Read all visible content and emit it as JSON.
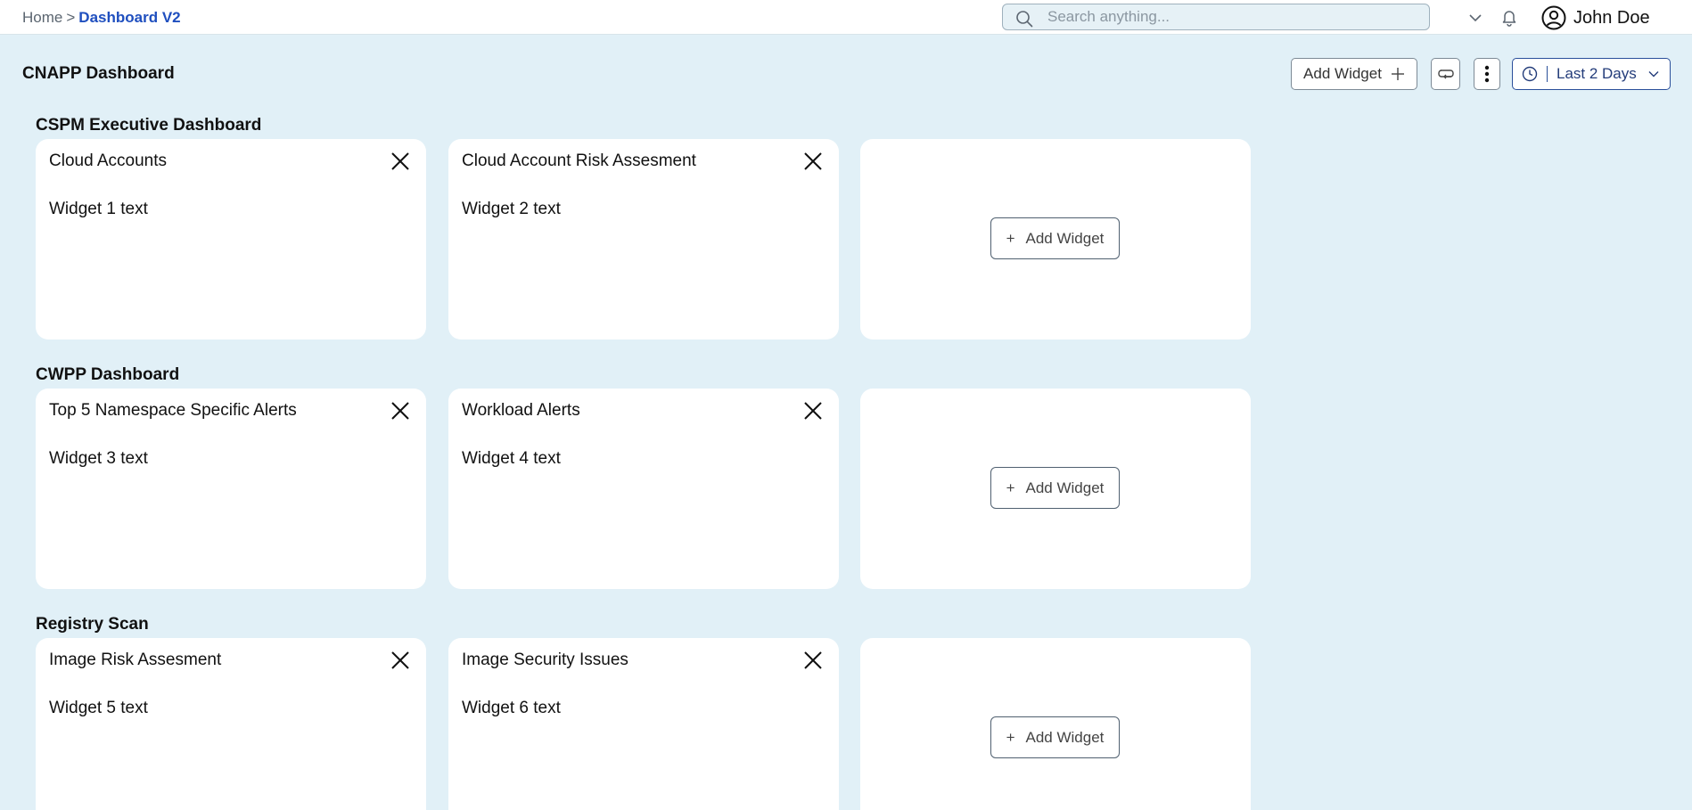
{
  "breadcrumb": {
    "home": "Home",
    "separator": ">",
    "current": "Dashboard V2"
  },
  "search": {
    "placeholder": "Search anything..."
  },
  "user": {
    "name": "John Doe"
  },
  "header": {
    "title": "CNAPP Dashboard",
    "add_widget_label": "Add Widget",
    "time_range_label": "Last 2 Days"
  },
  "colors": {
    "background": "#e1f0f7",
    "accent": "#1f4fbf",
    "card": "#ffffff"
  },
  "sections": [
    {
      "title": "CSPM Executive Dashboard",
      "widgets": [
        {
          "title": "Cloud Accounts",
          "text": "Widget 1 text"
        },
        {
          "title": "Cloud Account Risk Assesment",
          "text": "Widget 2 text"
        }
      ],
      "add_label": "Add Widget"
    },
    {
      "title": "CWPP Dashboard",
      "widgets": [
        {
          "title": "Top 5 Namespace Specific Alerts",
          "text": "Widget 3 text"
        },
        {
          "title": "Workload Alerts",
          "text": "Widget 4 text"
        }
      ],
      "add_label": "Add Widget"
    },
    {
      "title": "Registry Scan",
      "widgets": [
        {
          "title": "Image Risk Assesment",
          "text": "Widget 5 text"
        },
        {
          "title": "Image Security Issues",
          "text": "Widget 6 text"
        }
      ],
      "add_label": "Add Widget"
    }
  ],
  "icons": {
    "search": "search-icon",
    "dropdown": "chevron-down-icon",
    "notifications": "bell-icon",
    "user": "user-circle-icon",
    "add": "plus-icon",
    "refresh": "refresh-icon",
    "more": "more-vertical-icon",
    "clock": "clock-icon",
    "close": "close-icon"
  }
}
